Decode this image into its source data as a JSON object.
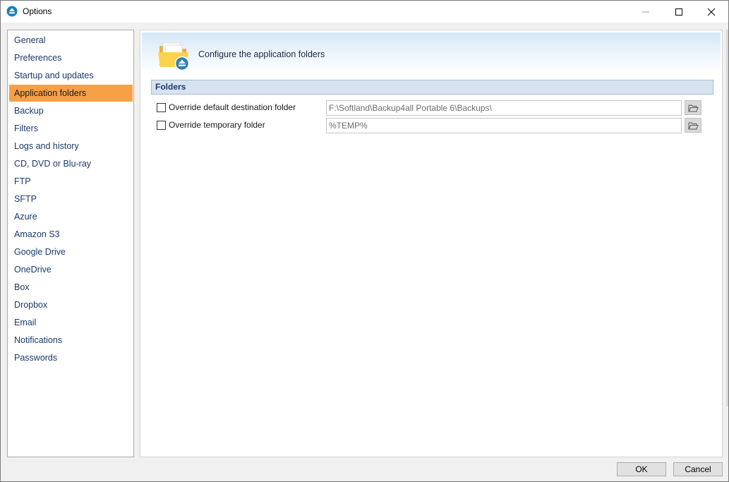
{
  "window": {
    "title": "Options",
    "colors": {
      "accent": "#f7a046",
      "nav_text": "#1b3a6b",
      "group_header": "#d7e3f0"
    }
  },
  "sidebar": {
    "items": [
      {
        "label": "General"
      },
      {
        "label": "Preferences"
      },
      {
        "label": "Startup and updates"
      },
      {
        "label": "Application folders",
        "selected": true
      },
      {
        "label": "Backup"
      },
      {
        "label": "Filters"
      },
      {
        "label": "Logs and history"
      },
      {
        "label": "CD, DVD or Blu-ray"
      },
      {
        "label": "FTP"
      },
      {
        "label": "SFTP"
      },
      {
        "label": "Azure"
      },
      {
        "label": "Amazon S3"
      },
      {
        "label": "Google Drive"
      },
      {
        "label": "OneDrive"
      },
      {
        "label": "Box"
      },
      {
        "label": "Dropbox"
      },
      {
        "label": "Email"
      },
      {
        "label": "Notifications"
      },
      {
        "label": "Passwords"
      }
    ]
  },
  "main": {
    "banner_title": "Configure the application folders",
    "banner_icon": "folder-eject-icon",
    "group_title": "Folders",
    "rows": [
      {
        "label": "Override default destination folder",
        "checked": false,
        "value": "F:\\Softland\\Backup4all Portable 6\\Backups\\",
        "browse_icon": "open-folder-icon"
      },
      {
        "label": "Override temporary folder",
        "checked": false,
        "value": "%TEMP%",
        "browse_icon": "open-folder-icon"
      }
    ]
  },
  "footer": {
    "ok_label": "OK",
    "cancel_label": "Cancel"
  }
}
